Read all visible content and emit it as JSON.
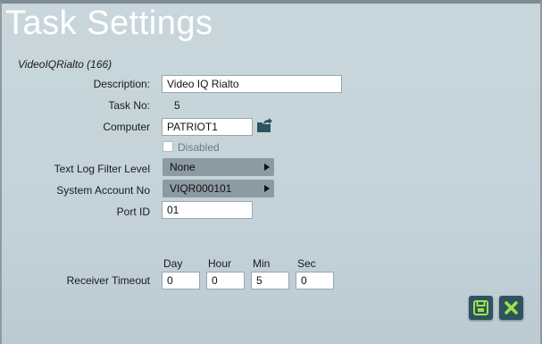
{
  "window": {
    "title": "Task Settings",
    "subtitle": "VideoIQRialto (166)"
  },
  "form": {
    "description": {
      "label": "Description:",
      "value": "Video IQ Rialto"
    },
    "task_no": {
      "label": "Task No:",
      "value": "5"
    },
    "computer": {
      "label": "Computer",
      "value": "PATRIOT1",
      "icon": "folder-export-icon"
    },
    "disabled": {
      "label": "Disabled",
      "checked": false
    },
    "text_log_filter_level": {
      "label": "Text Log Filter Level",
      "selected": "None"
    },
    "system_account_no": {
      "label": "System Account No",
      "selected": "VIQR000101"
    },
    "port_id": {
      "label": "Port ID",
      "value": "01"
    },
    "receiver_timeout": {
      "label": "Receiver Timeout",
      "columns": [
        "Day",
        "Hour",
        "Min",
        "Sec"
      ],
      "values": [
        "0",
        "0",
        "5",
        "0"
      ]
    }
  },
  "actions": {
    "save_icon": "save-icon",
    "cancel_icon": "close-icon"
  },
  "colors": {
    "background": "#c4d3d9",
    "dropdown": "#8c9aa1",
    "button": "#2e5361",
    "button_icon": "#9be34a"
  }
}
